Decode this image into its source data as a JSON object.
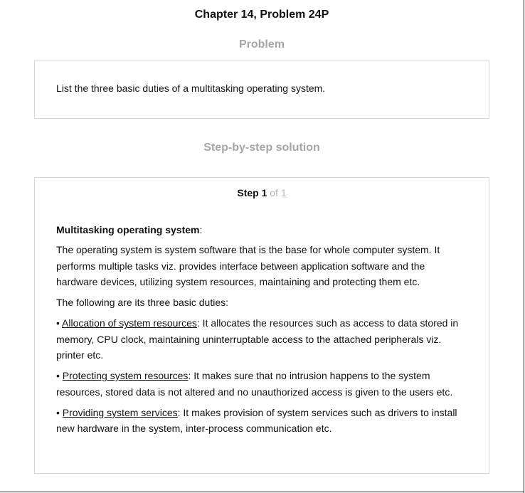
{
  "header": {
    "title": "Chapter 14, Problem 24P"
  },
  "problem": {
    "heading": "Problem",
    "text": "List the three basic duties of a multitasking operating system."
  },
  "solution": {
    "heading": "Step-by-step solution",
    "step": {
      "label": "Step 1",
      "of": " of 1"
    },
    "definition_title": "Multitasking operating system",
    "definition_colon": ":",
    "paragraph1": "The operating system is system software that is the base for whole computer system. It performs multiple tasks viz. provides interface between application software and the hardware devices, utilizing system resources, maintaining and protecting them etc.",
    "intro": "The following are its three basic duties:",
    "bullet_symbol": "• ",
    "duties": [
      {
        "term": "Allocation of system resources",
        "text": ": It allocates the resources such as access to data stored in memory, CPU clock, maintaining uninterruptable access to the attached peripherals viz. printer etc."
      },
      {
        "term": "Protecting system resources",
        "text": ": It makes sure that no intrusion happens to the system resources, stored data is not altered and no unauthorized access is given to the users etc."
      },
      {
        "term": "Providing system services",
        "text": ": It makes provision of system services such as drivers to install new hardware in the system, inter-process communication etc."
      }
    ]
  }
}
